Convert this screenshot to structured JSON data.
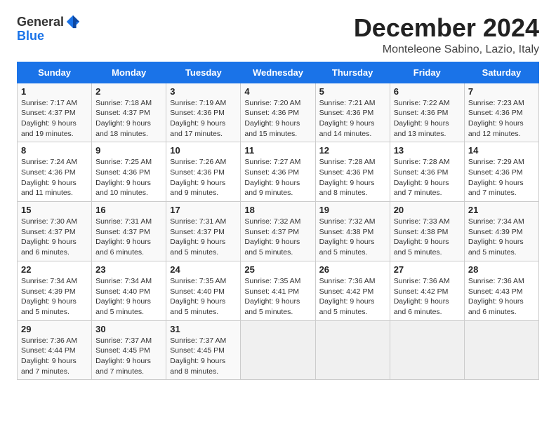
{
  "header": {
    "logo_general": "General",
    "logo_blue": "Blue",
    "title": "December 2024",
    "subtitle": "Monteleone Sabino, Lazio, Italy"
  },
  "columns": [
    "Sunday",
    "Monday",
    "Tuesday",
    "Wednesday",
    "Thursday",
    "Friday",
    "Saturday"
  ],
  "weeks": [
    [
      {
        "day": "1",
        "sunrise": "Sunrise: 7:17 AM",
        "sunset": "Sunset: 4:37 PM",
        "daylight": "Daylight: 9 hours and 19 minutes."
      },
      {
        "day": "2",
        "sunrise": "Sunrise: 7:18 AM",
        "sunset": "Sunset: 4:37 PM",
        "daylight": "Daylight: 9 hours and 18 minutes."
      },
      {
        "day": "3",
        "sunrise": "Sunrise: 7:19 AM",
        "sunset": "Sunset: 4:36 PM",
        "daylight": "Daylight: 9 hours and 17 minutes."
      },
      {
        "day": "4",
        "sunrise": "Sunrise: 7:20 AM",
        "sunset": "Sunset: 4:36 PM",
        "daylight": "Daylight: 9 hours and 15 minutes."
      },
      {
        "day": "5",
        "sunrise": "Sunrise: 7:21 AM",
        "sunset": "Sunset: 4:36 PM",
        "daylight": "Daylight: 9 hours and 14 minutes."
      },
      {
        "day": "6",
        "sunrise": "Sunrise: 7:22 AM",
        "sunset": "Sunset: 4:36 PM",
        "daylight": "Daylight: 9 hours and 13 minutes."
      },
      {
        "day": "7",
        "sunrise": "Sunrise: 7:23 AM",
        "sunset": "Sunset: 4:36 PM",
        "daylight": "Daylight: 9 hours and 12 minutes."
      }
    ],
    [
      {
        "day": "8",
        "sunrise": "Sunrise: 7:24 AM",
        "sunset": "Sunset: 4:36 PM",
        "daylight": "Daylight: 9 hours and 11 minutes."
      },
      {
        "day": "9",
        "sunrise": "Sunrise: 7:25 AM",
        "sunset": "Sunset: 4:36 PM",
        "daylight": "Daylight: 9 hours and 10 minutes."
      },
      {
        "day": "10",
        "sunrise": "Sunrise: 7:26 AM",
        "sunset": "Sunset: 4:36 PM",
        "daylight": "Daylight: 9 hours and 9 minutes."
      },
      {
        "day": "11",
        "sunrise": "Sunrise: 7:27 AM",
        "sunset": "Sunset: 4:36 PM",
        "daylight": "Daylight: 9 hours and 9 minutes."
      },
      {
        "day": "12",
        "sunrise": "Sunrise: 7:28 AM",
        "sunset": "Sunset: 4:36 PM",
        "daylight": "Daylight: 9 hours and 8 minutes."
      },
      {
        "day": "13",
        "sunrise": "Sunrise: 7:28 AM",
        "sunset": "Sunset: 4:36 PM",
        "daylight": "Daylight: 9 hours and 7 minutes."
      },
      {
        "day": "14",
        "sunrise": "Sunrise: 7:29 AM",
        "sunset": "Sunset: 4:36 PM",
        "daylight": "Daylight: 9 hours and 7 minutes."
      }
    ],
    [
      {
        "day": "15",
        "sunrise": "Sunrise: 7:30 AM",
        "sunset": "Sunset: 4:37 PM",
        "daylight": "Daylight: 9 hours and 6 minutes."
      },
      {
        "day": "16",
        "sunrise": "Sunrise: 7:31 AM",
        "sunset": "Sunset: 4:37 PM",
        "daylight": "Daylight: 9 hours and 6 minutes."
      },
      {
        "day": "17",
        "sunrise": "Sunrise: 7:31 AM",
        "sunset": "Sunset: 4:37 PM",
        "daylight": "Daylight: 9 hours and 5 minutes."
      },
      {
        "day": "18",
        "sunrise": "Sunrise: 7:32 AM",
        "sunset": "Sunset: 4:37 PM",
        "daylight": "Daylight: 9 hours and 5 minutes."
      },
      {
        "day": "19",
        "sunrise": "Sunrise: 7:32 AM",
        "sunset": "Sunset: 4:38 PM",
        "daylight": "Daylight: 9 hours and 5 minutes."
      },
      {
        "day": "20",
        "sunrise": "Sunrise: 7:33 AM",
        "sunset": "Sunset: 4:38 PM",
        "daylight": "Daylight: 9 hours and 5 minutes."
      },
      {
        "day": "21",
        "sunrise": "Sunrise: 7:34 AM",
        "sunset": "Sunset: 4:39 PM",
        "daylight": "Daylight: 9 hours and 5 minutes."
      }
    ],
    [
      {
        "day": "22",
        "sunrise": "Sunrise: 7:34 AM",
        "sunset": "Sunset: 4:39 PM",
        "daylight": "Daylight: 9 hours and 5 minutes."
      },
      {
        "day": "23",
        "sunrise": "Sunrise: 7:34 AM",
        "sunset": "Sunset: 4:40 PM",
        "daylight": "Daylight: 9 hours and 5 minutes."
      },
      {
        "day": "24",
        "sunrise": "Sunrise: 7:35 AM",
        "sunset": "Sunset: 4:40 PM",
        "daylight": "Daylight: 9 hours and 5 minutes."
      },
      {
        "day": "25",
        "sunrise": "Sunrise: 7:35 AM",
        "sunset": "Sunset: 4:41 PM",
        "daylight": "Daylight: 9 hours and 5 minutes."
      },
      {
        "day": "26",
        "sunrise": "Sunrise: 7:36 AM",
        "sunset": "Sunset: 4:42 PM",
        "daylight": "Daylight: 9 hours and 5 minutes."
      },
      {
        "day": "27",
        "sunrise": "Sunrise: 7:36 AM",
        "sunset": "Sunset: 4:42 PM",
        "daylight": "Daylight: 9 hours and 6 minutes."
      },
      {
        "day": "28",
        "sunrise": "Sunrise: 7:36 AM",
        "sunset": "Sunset: 4:43 PM",
        "daylight": "Daylight: 9 hours and 6 minutes."
      }
    ],
    [
      {
        "day": "29",
        "sunrise": "Sunrise: 7:36 AM",
        "sunset": "Sunset: 4:44 PM",
        "daylight": "Daylight: 9 hours and 7 minutes."
      },
      {
        "day": "30",
        "sunrise": "Sunrise: 7:37 AM",
        "sunset": "Sunset: 4:45 PM",
        "daylight": "Daylight: 9 hours and 7 minutes."
      },
      {
        "day": "31",
        "sunrise": "Sunrise: 7:37 AM",
        "sunset": "Sunset: 4:45 PM",
        "daylight": "Daylight: 9 hours and 8 minutes."
      },
      null,
      null,
      null,
      null
    ]
  ]
}
